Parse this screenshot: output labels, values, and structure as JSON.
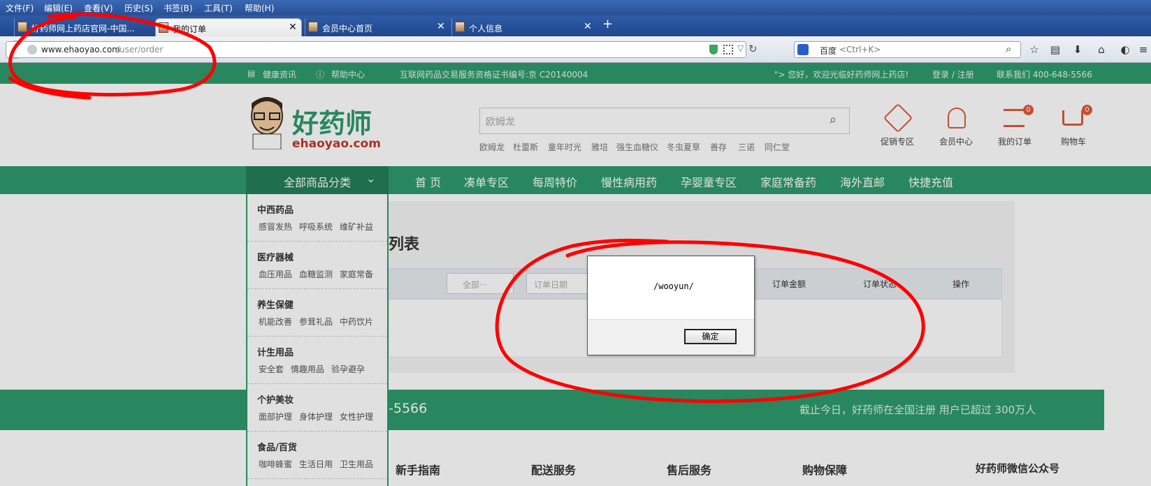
{
  "menu": [
    "文件(F)",
    "编辑(E)",
    "查看(V)",
    "历史(S)",
    "书签(B)",
    "工具(T)",
    "帮助(H)"
  ],
  "tabs": [
    {
      "label": "好药师网上药店官网-中国..."
    },
    {
      "label": "我的订单"
    },
    {
      "label": "会员中心首页"
    },
    {
      "label": "个人信息"
    }
  ],
  "close_glyph": "✕",
  "url": {
    "host": "www.ehaoyao.com",
    "path": "/user/order"
  },
  "search": {
    "engine": "百度",
    "placeholder": "<Ctrl+K>"
  },
  "topbar": {
    "health": "健康资讯",
    "help": "帮助中心",
    "license": "互联网药品交易服务资格证书编号:京 C20140004",
    "welcome": "\"> 您好，欢迎光临好药师网上药店!",
    "login": "登录 / 注册",
    "contact": "联系我们 400-648-5566"
  },
  "logo": {
    "cn": "好药师",
    "en": "ehaoyao.com"
  },
  "site_search": {
    "placeholder": "欧姆龙",
    "hot": [
      "欧姆龙",
      "杜蕾斯",
      "童年时光",
      "雅培",
      "强生血糖仪",
      "冬虫夏草",
      "善存",
      "三诺",
      "同仁堂"
    ]
  },
  "header_icons": [
    {
      "label": "促销专区",
      "badge": ""
    },
    {
      "label": "会员中心",
      "badge": ""
    },
    {
      "label": "我的订单",
      "badge": "0"
    },
    {
      "label": "购物车",
      "badge": "0"
    }
  ],
  "catnav": {
    "all": "全部商品分类",
    "items": [
      "首 页",
      "凑单专区",
      "每周特价",
      "慢性病用药",
      "孕婴童专区",
      "家庭常备药",
      "海外直邮",
      "快捷充值"
    ]
  },
  "sidebar": [
    {
      "title": "中西药品",
      "subs": [
        "感冒发热",
        "呼吸系统",
        "维矿补益"
      ]
    },
    {
      "title": "医疗器械",
      "subs": [
        "血压用品",
        "血糖监测",
        "家庭常备"
      ]
    },
    {
      "title": "养生保健",
      "subs": [
        "机能改善",
        "参茸礼品",
        "中药饮片"
      ]
    },
    {
      "title": "计生用品",
      "subs": [
        "安全套",
        "情趣用品",
        "验孕避孕"
      ]
    },
    {
      "title": "个护美妆",
      "subs": [
        "面部护理",
        "身体护理",
        "女性护理"
      ]
    },
    {
      "title": "食品/百货",
      "subs": [
        "咖啡蜂蜜",
        "生活日用",
        "卫生用品"
      ]
    }
  ],
  "order": {
    "title_fragment": "列表",
    "filter_all": "全部···",
    "date_placeholder": "订单日期",
    "headers": [
      "订单金额",
      "订单状态",
      "操作"
    ]
  },
  "banner": {
    "phone_fragment": "-5566",
    "text": "截止今日，好药师在全国注册 用户已超过 300万人"
  },
  "footer": [
    "新手指南",
    "配送服务",
    "售后服务",
    "购物保障",
    "好药师微信公众号"
  ],
  "dialog": {
    "message": "/wooyun/",
    "ok": "确定"
  },
  "colors": {
    "brand_green": "#2e9a6b",
    "annotation_red": "#ff0000",
    "tab_blue": "#2f5ba6"
  }
}
